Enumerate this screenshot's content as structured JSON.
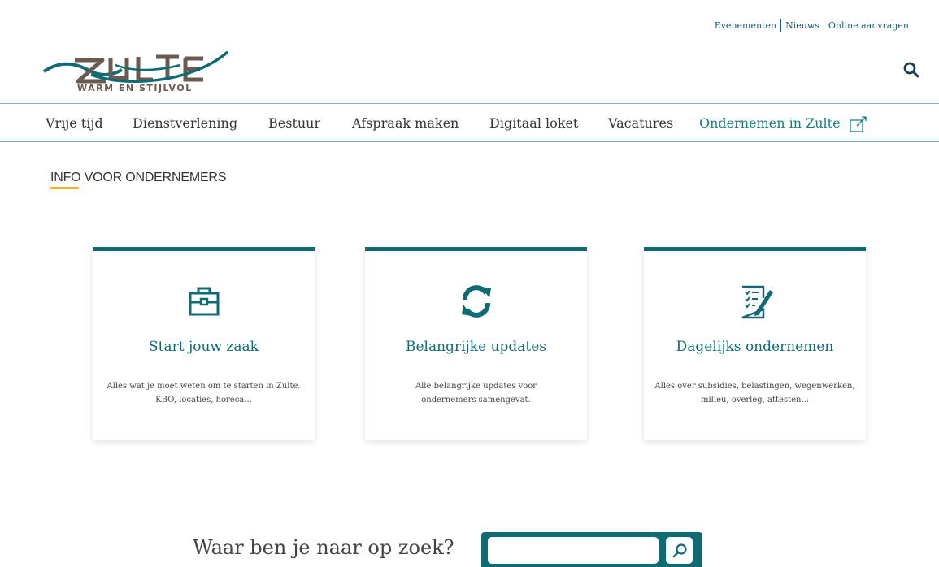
{
  "top_links": [
    "Evenementen",
    "Nieuws",
    "Online aanvragen"
  ],
  "logo": {
    "name": "ZULTE",
    "tagline": "WARM EN STIJLVOL"
  },
  "nav": {
    "items": [
      "Vrije tijd",
      "Dienstverlening",
      "Bestuur",
      "Afspraak maken",
      "Digitaal loket",
      "Vacatures",
      "Ondernemen in Zulte"
    ]
  },
  "section": {
    "title": "INFO VOOR ONDERNEMERS"
  },
  "cards": [
    {
      "icon": "briefcase-icon",
      "title": "Start jouw zaak",
      "desc_line1": "Alles wat je moet weten om te starten in Zulte.",
      "desc_line2": "KBO, locaties, horeca..."
    },
    {
      "icon": "refresh-icon",
      "title": "Belangrijke updates",
      "desc_line1": "Alle belangrijke updates voor",
      "desc_line2": "ondernemers samengevat."
    },
    {
      "icon": "checklist-pen-icon",
      "title": "Dagelijks ondernemen",
      "desc_line1": "Alles over subsidies, belastingen, wegenwerken,",
      "desc_line2": "milieu, overleg, attesten..."
    }
  ],
  "bottom_search": {
    "question": "Waar ben je naar op zoek?",
    "placeholder": ""
  },
  "colors": {
    "teal": "#0f6b73",
    "accent": "#157f85",
    "yellow": "#f2b51c",
    "brown": "#6b5a4f"
  }
}
